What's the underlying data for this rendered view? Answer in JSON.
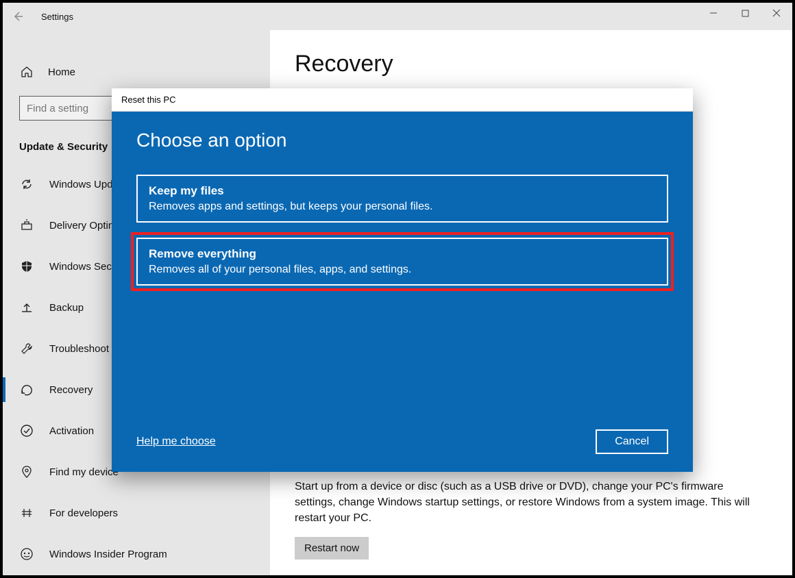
{
  "window": {
    "title": "Settings"
  },
  "sidebar": {
    "home_label": "Home",
    "search_placeholder": "Find a setting",
    "section_title": "Update & Security",
    "items": [
      {
        "label": "Windows Update"
      },
      {
        "label": "Delivery Optimization"
      },
      {
        "label": "Windows Security"
      },
      {
        "label": "Backup"
      },
      {
        "label": "Troubleshoot"
      },
      {
        "label": "Recovery"
      },
      {
        "label": "Activation"
      },
      {
        "label": "Find my device"
      },
      {
        "label": "For developers"
      },
      {
        "label": "Windows Insider Program"
      }
    ]
  },
  "main": {
    "heading": "Recovery",
    "advanced_text": "Start up from a device or disc (such as a USB drive or DVD), change your PC's firmware settings, change Windows startup settings, or restore Windows from a system image. This will restart your PC.",
    "restart_label": "Restart now"
  },
  "dialog": {
    "header": "Reset this PC",
    "title": "Choose an option",
    "options": [
      {
        "title": "Keep my files",
        "desc": "Removes apps and settings, but keeps your personal files."
      },
      {
        "title": "Remove everything",
        "desc": "Removes all of your personal files, apps, and settings."
      }
    ],
    "help_label": "Help me choose",
    "cancel_label": "Cancel"
  }
}
